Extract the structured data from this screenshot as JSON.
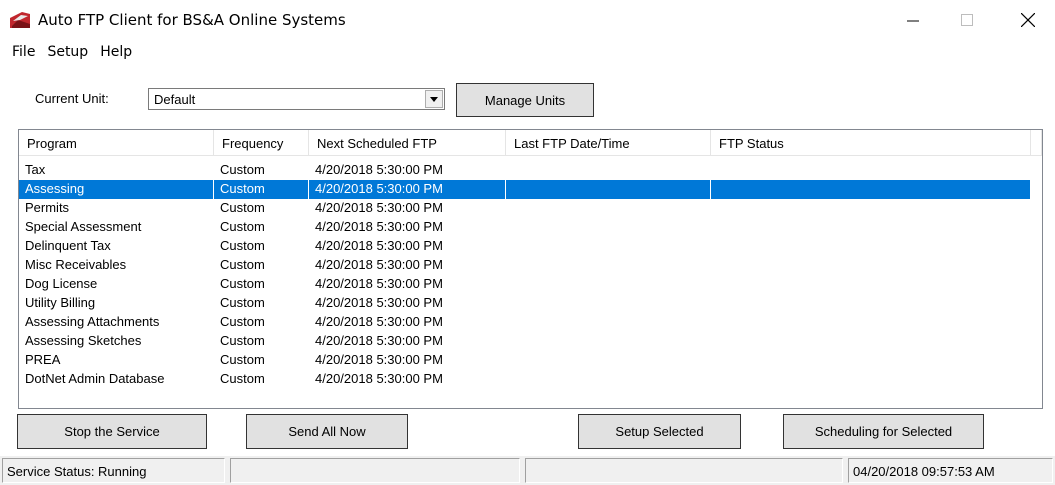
{
  "window": {
    "title": "Auto FTP Client for BS&A Online Systems"
  },
  "menu": [
    "File",
    "Setup",
    "Help"
  ],
  "toolbar": {
    "current_unit_label": "Current Unit:",
    "current_unit_value": "Default",
    "manage_units_label": "Manage Units"
  },
  "table": {
    "columns": [
      "Program",
      "Frequency",
      "Next Scheduled FTP",
      "Last FTP Date/Time",
      "FTP Status"
    ],
    "selected_row": 1,
    "rows": [
      [
        "Tax",
        "Custom",
        "4/20/2018 5:30:00 PM",
        "",
        ""
      ],
      [
        "Assessing",
        "Custom",
        "4/20/2018 5:30:00 PM",
        "",
        ""
      ],
      [
        "Permits",
        "Custom",
        "4/20/2018 5:30:00 PM",
        "",
        ""
      ],
      [
        "Special Assessment",
        "Custom",
        "4/20/2018 5:30:00 PM",
        "",
        ""
      ],
      [
        "Delinquent Tax",
        "Custom",
        "4/20/2018 5:30:00 PM",
        "",
        ""
      ],
      [
        "Misc Receivables",
        "Custom",
        "4/20/2018 5:30:00 PM",
        "",
        ""
      ],
      [
        "Dog License",
        "Custom",
        "4/20/2018 5:30:00 PM",
        "",
        ""
      ],
      [
        "Utility Billing",
        "Custom",
        "4/20/2018 5:30:00 PM",
        "",
        ""
      ],
      [
        "Assessing Attachments",
        "Custom",
        "4/20/2018 5:30:00 PM",
        "",
        ""
      ],
      [
        "Assessing Sketches",
        "Custom",
        "4/20/2018 5:30:00 PM",
        "",
        ""
      ],
      [
        "PREA",
        "Custom",
        "4/20/2018 5:30:00 PM",
        "",
        ""
      ],
      [
        "DotNet Admin Database",
        "Custom",
        "4/20/2018 5:30:00 PM",
        "",
        ""
      ]
    ]
  },
  "actions": {
    "stop_service": "Stop the Service",
    "send_all_now": "Send All Now",
    "setup_selected": "Setup Selected",
    "scheduling_for_selected": "Scheduling for Selected"
  },
  "status": {
    "service_status": "Service Status:  Running",
    "panel2": "",
    "panel3": "",
    "datetime": "04/20/2018 09:57:53 AM"
  },
  "colors": {
    "selection": "#0078d7",
    "icon_red": "#c0262d"
  },
  "icons": {
    "app": "bsa-logo-icon",
    "minimize": "minimize-icon",
    "maximize": "maximize-icon",
    "close": "close-icon",
    "dropdown": "chevron-down-icon"
  }
}
